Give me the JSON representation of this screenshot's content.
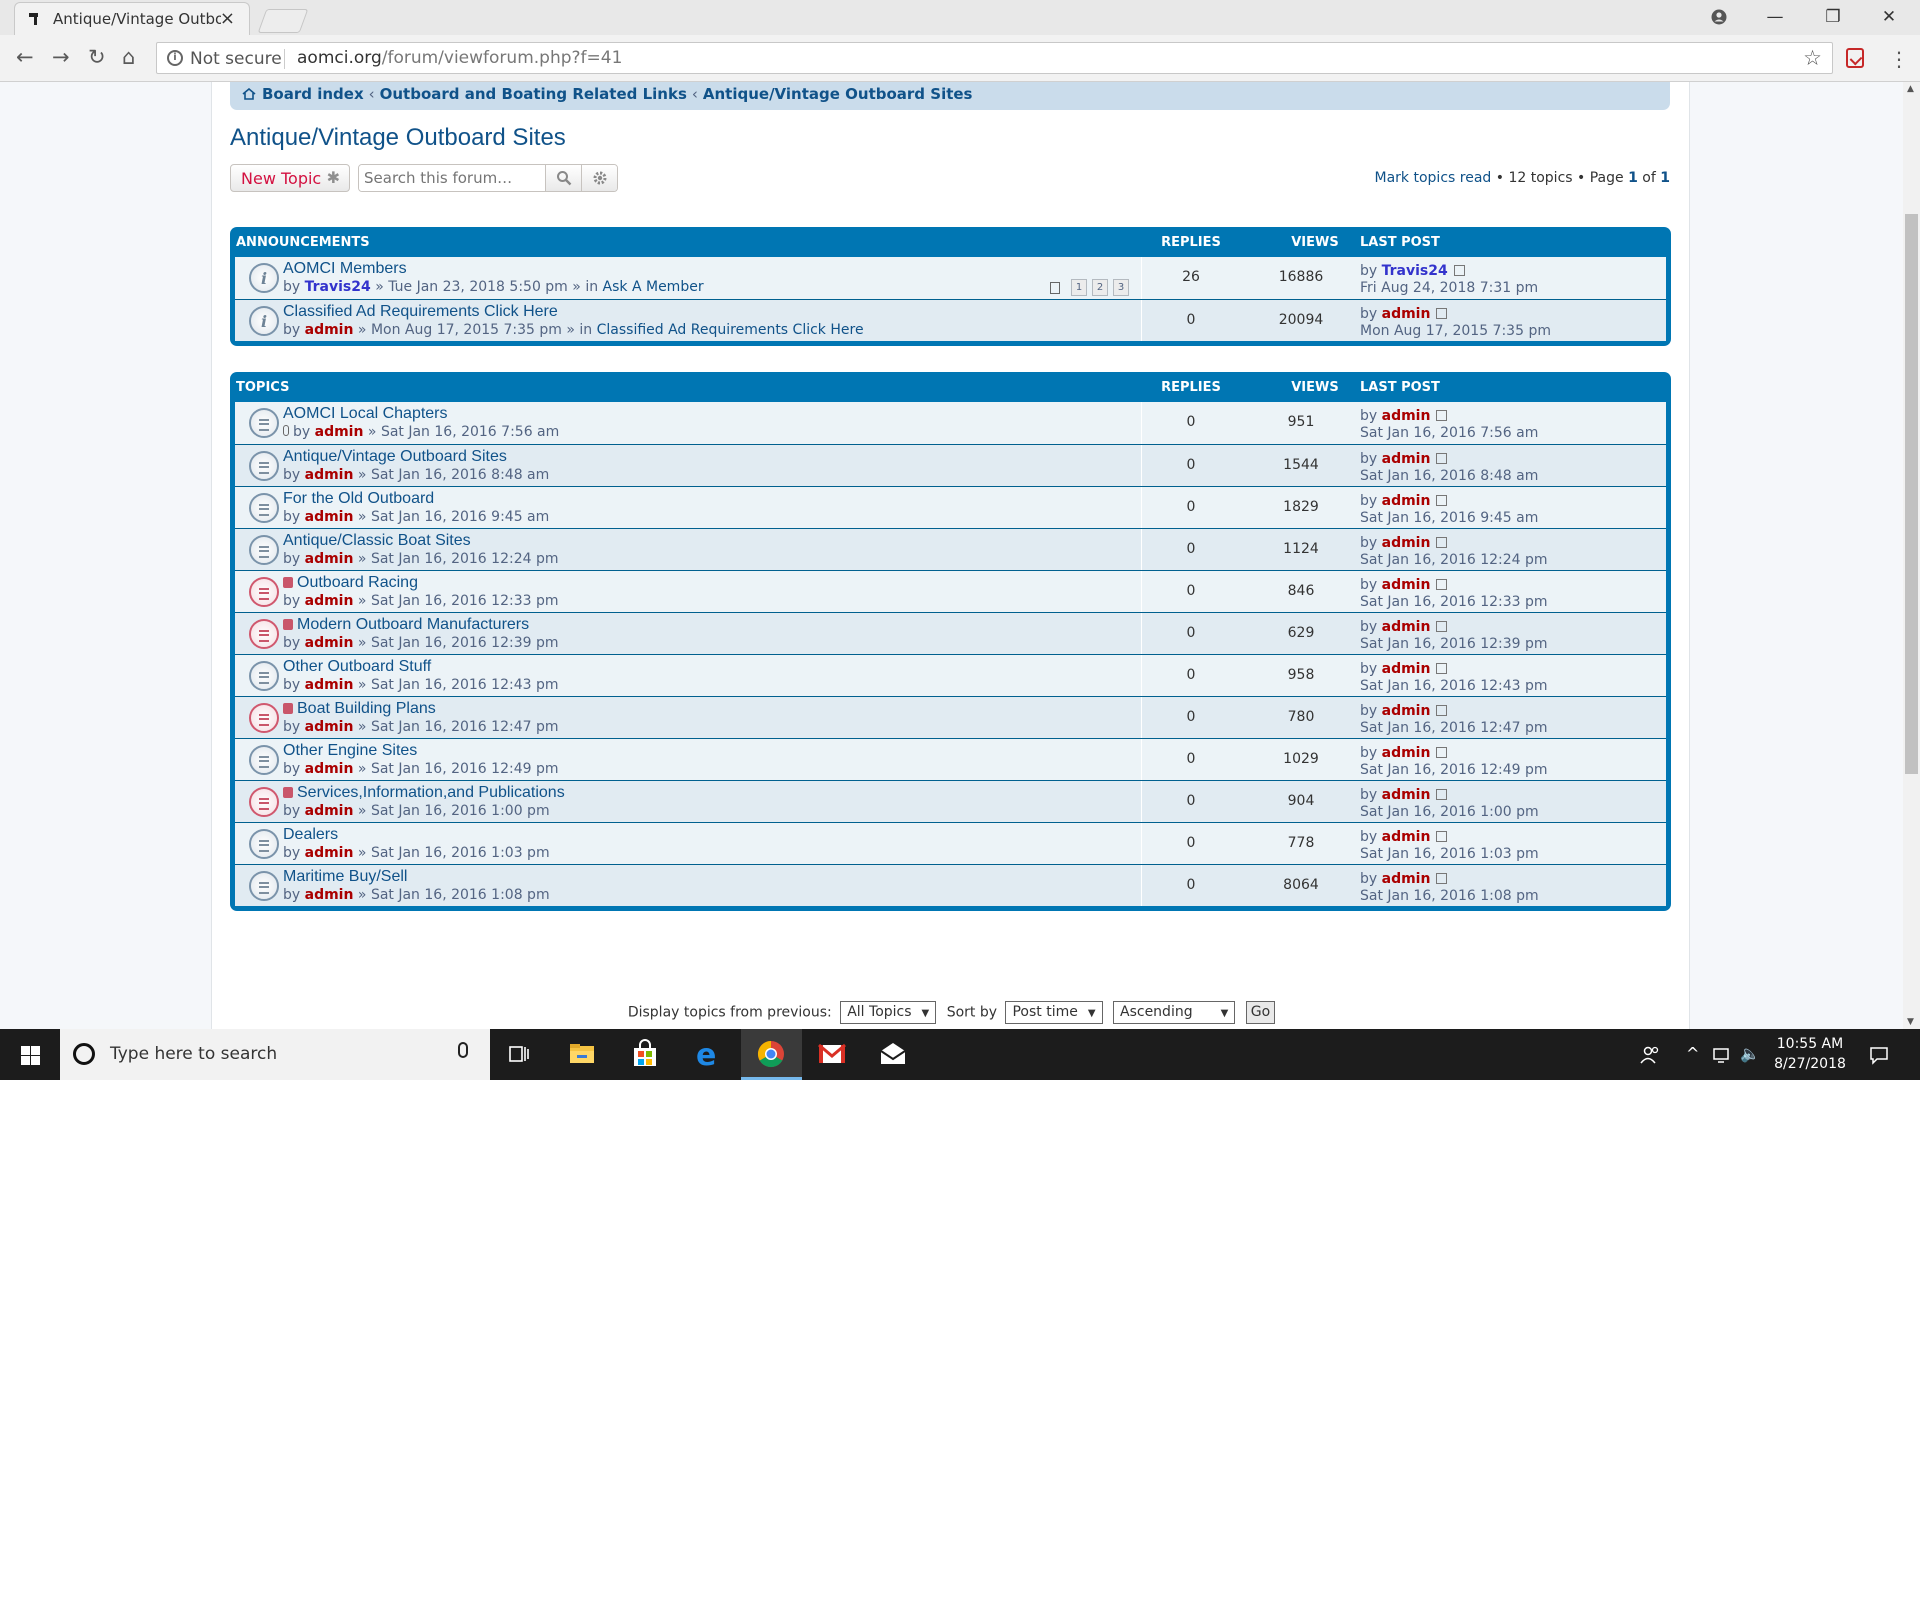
{
  "browser": {
    "tab_title": "Antique/Vintage Outboa",
    "not_secure": "Not secure",
    "url_host": "aomci.org",
    "url_path": "/forum/viewforum.php?f=41"
  },
  "breadcrumb": [
    "Board index",
    "Outboard and Boating Related Links",
    "Antique/Vintage Outboard Sites"
  ],
  "forum_title": "Antique/Vintage Outboard Sites",
  "actions": {
    "new_topic": "New Topic",
    "search_placeholder": "Search this forum…",
    "mark_read": "Mark topics read",
    "topics_count": "12 topics",
    "page_label": "Page",
    "page_current": "1",
    "page_of": "of",
    "page_total": "1"
  },
  "announcements_header": {
    "title": "ANNOUNCEMENTS",
    "replies": "REPLIES",
    "views": "VIEWS",
    "last_post": "LAST POST"
  },
  "topics_header": {
    "title": "TOPICS",
    "replies": "REPLIES",
    "views": "VIEWS",
    "last_post": "LAST POST"
  },
  "announcements": [
    {
      "title": "AOMCI Members",
      "author": "Travis24",
      "date": "Tue Jan 23, 2018 5:50 pm",
      "in_forum": "Ask A Member",
      "pages": [
        "1",
        "2",
        "3"
      ],
      "replies": "26",
      "views": "16886",
      "last_author": "Travis24",
      "last_date": "Fri Aug 24, 2018 7:31 pm"
    },
    {
      "title": "Classified Ad Requirements Click Here",
      "author": "admin",
      "date": "Mon Aug 17, 2015 7:35 pm",
      "in_forum": "Classified Ad Requirements Click Here",
      "replies": "0",
      "views": "20094",
      "last_author": "admin",
      "last_date": "Mon Aug 17, 2015 7:35 pm"
    }
  ],
  "topics": [
    {
      "title": "AOMCI Local Chapters",
      "author": "admin",
      "date": "Sat Jan 16, 2016 7:56 am",
      "replies": "0",
      "views": "951",
      "last_author": "admin",
      "last_date": "Sat Jan 16, 2016 7:56 am"
    },
    {
      "title": "Antique/Vintage Outboard Sites",
      "author": "admin",
      "date": "Sat Jan 16, 2016 8:48 am",
      "replies": "0",
      "views": "1544",
      "last_author": "admin",
      "last_date": "Sat Jan 16, 2016 8:48 am"
    },
    {
      "title": "For the Old Outboard",
      "author": "admin",
      "date": "Sat Jan 16, 2016 9:45 am",
      "replies": "0",
      "views": "1829",
      "last_author": "admin",
      "last_date": "Sat Jan 16, 2016 9:45 am"
    },
    {
      "title": "Antique/Classic Boat Sites",
      "author": "admin",
      "date": "Sat Jan 16, 2016 12:24 pm",
      "replies": "0",
      "views": "1124",
      "last_author": "admin",
      "last_date": "Sat Jan 16, 2016 12:24 pm"
    },
    {
      "title": "Outboard Racing",
      "author": "admin",
      "date": "Sat Jan 16, 2016 12:33 pm",
      "replies": "0",
      "views": "846",
      "last_author": "admin",
      "last_date": "Sat Jan 16, 2016 12:33 pm"
    },
    {
      "title": "Modern Outboard Manufacturers",
      "author": "admin",
      "date": "Sat Jan 16, 2016 12:39 pm",
      "replies": "0",
      "views": "629",
      "last_author": "admin",
      "last_date": "Sat Jan 16, 2016 12:39 pm"
    },
    {
      "title": "Other Outboard Stuff",
      "author": "admin",
      "date": "Sat Jan 16, 2016 12:43 pm",
      "replies": "0",
      "views": "958",
      "last_author": "admin",
      "last_date": "Sat Jan 16, 2016 12:43 pm"
    },
    {
      "title": "Boat Building Plans",
      "author": "admin",
      "date": "Sat Jan 16, 2016 12:47 pm",
      "replies": "0",
      "views": "780",
      "last_author": "admin",
      "last_date": "Sat Jan 16, 2016 12:47 pm"
    },
    {
      "title": "Other Engine Sites",
      "author": "admin",
      "date": "Sat Jan 16, 2016 12:49 pm",
      "replies": "0",
      "views": "1029",
      "last_author": "admin",
      "last_date": "Sat Jan 16, 2016 12:49 pm"
    },
    {
      "title": "Services,Information,and Publications",
      "author": "admin",
      "date": "Sat Jan 16, 2016 1:00 pm",
      "replies": "0",
      "views": "904",
      "last_author": "admin",
      "last_date": "Sat Jan 16, 2016 1:00 pm"
    },
    {
      "title": "Dealers",
      "author": "admin",
      "date": "Sat Jan 16, 2016 1:03 pm",
      "replies": "0",
      "views": "778",
      "last_author": "admin",
      "last_date": "Sat Jan 16, 2016 1:03 pm"
    },
    {
      "title": "Maritime Buy/Sell",
      "author": "admin",
      "date": "Sat Jan 16, 2016 1:08 pm",
      "replies": "0",
      "views": "8064",
      "last_author": "admin",
      "last_date": "Sat Jan 16, 2016 1:08 pm"
    }
  ],
  "labels": {
    "by": "by",
    "in": "in",
    "sep": "»"
  },
  "sortbar": {
    "display_label": "Display topics from previous:",
    "display_value": "All Topics",
    "sort_label": "Sort by",
    "sort_value": "Post time",
    "order_value": "Ascending",
    "go": "Go"
  },
  "taskbar": {
    "search_placeholder": "Type here to search",
    "time": "10:55 AM",
    "date": "8/27/2018"
  },
  "colors": {
    "forum_blue": "#0076b3",
    "link": "#105289",
    "admin_red": "#aa0000",
    "member_blue": "#3333cc"
  }
}
